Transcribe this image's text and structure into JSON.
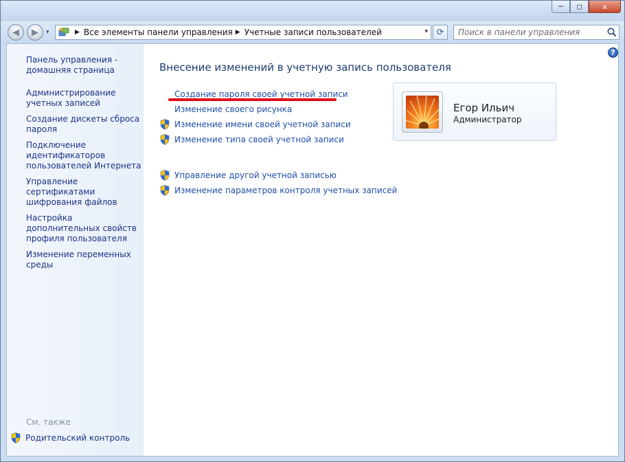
{
  "window": {
    "minimize_glyph": "─",
    "maximize_glyph": "□",
    "close_glyph": "✕"
  },
  "navigation": {
    "back_glyph": "◀",
    "forward_glyph": "▶",
    "history_glyph": "▾",
    "breadcrumb": [
      "Все элементы панели управления",
      "Учетные записи пользователей"
    ],
    "separator_glyph": "▶",
    "dropdown_glyph": "▾",
    "refresh_glyph": "⟳",
    "search_placeholder": "Поиск в панели управления"
  },
  "sidebar": {
    "home_link": "Панель управления - домашняя страница",
    "items": [
      "Администрирование учетных записей",
      "Создание дискеты сброса пароля",
      "Подключение идентификаторов пользователей Интернета",
      "Управление сертификатами шифрования файлов",
      "Настройка дополнительных свойств профиля пользователя",
      "Изменение переменных среды"
    ],
    "see_also": "См. также",
    "parental_control": "Родительский контроль"
  },
  "main": {
    "help_glyph": "?",
    "title": "Внесение изменений в учетную запись пользователя",
    "tasks": [
      {
        "label": "Создание пароля своей учетной записи",
        "shield": false
      },
      {
        "label": "Изменение своего рисунка",
        "shield": false
      },
      {
        "label": "Изменение имени своей учетной записи",
        "shield": true
      },
      {
        "label": "Изменение типа своей учетной записи",
        "shield": true
      }
    ],
    "other_tasks": [
      {
        "label": "Управление другой учетной записью",
        "shield": true
      },
      {
        "label": "Изменение параметров контроля учетных записей",
        "shield": true
      }
    ],
    "annotation_color": "#e3101b"
  },
  "user": {
    "name": "Егор Ильич",
    "role": "Администратор",
    "avatar_icon": "orange-flower-icon"
  },
  "colors": {
    "link": "#1e4ea8",
    "sidebar_link": "#1e3287",
    "title": "#1e3c6e",
    "annotation": "#e3101b"
  }
}
